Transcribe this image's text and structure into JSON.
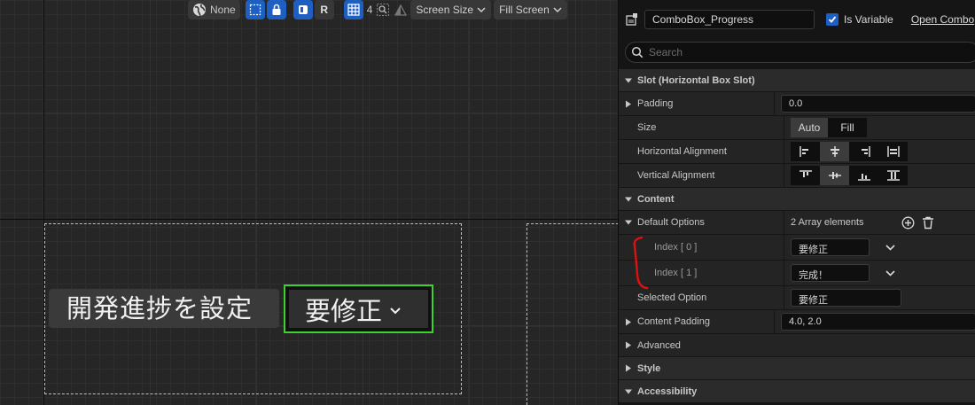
{
  "toolbar": {
    "localization": "None",
    "respect_lock_label": "R",
    "grid_snap": "4",
    "screen_size": "Screen Size",
    "fill_screen": "Fill Screen"
  },
  "canvas": {
    "label_text": "開発進捗を設定",
    "combo_value": "要修正"
  },
  "details": {
    "widget_name": "ComboBox_Progress",
    "is_variable_label": "Is Variable",
    "is_variable_checked": true,
    "open_link": "Open Combo",
    "search_placeholder": "Search"
  },
  "sections": {
    "slot": "Slot (Horizontal Box Slot)",
    "content": "Content",
    "advanced": "Advanced",
    "style": "Style",
    "accessibility": "Accessibility"
  },
  "props": {
    "padding": {
      "label": "Padding",
      "value": "0.0"
    },
    "size": {
      "label": "Size",
      "options": [
        "Auto",
        "Fill"
      ],
      "selected": "Auto"
    },
    "h_align": {
      "label": "Horizontal Alignment",
      "selected_index": 1
    },
    "v_align": {
      "label": "Vertical Alignment",
      "selected_index": 1
    },
    "default_options": {
      "label": "Default Options",
      "summary": "2 Array elements",
      "items": [
        {
          "index_label": "Index [ 0 ]",
          "value": "要修正"
        },
        {
          "index_label": "Index [ 1 ]",
          "value": "完成！"
        }
      ]
    },
    "selected_option": {
      "label": "Selected Option",
      "value": "要修正"
    },
    "content_padding": {
      "label": "Content Padding",
      "value": "4.0, 2.0"
    }
  },
  "colors": {
    "accent_blue": "#1d5fc2",
    "selection_green": "#3fd12e",
    "annotation_red": "#e01010"
  }
}
